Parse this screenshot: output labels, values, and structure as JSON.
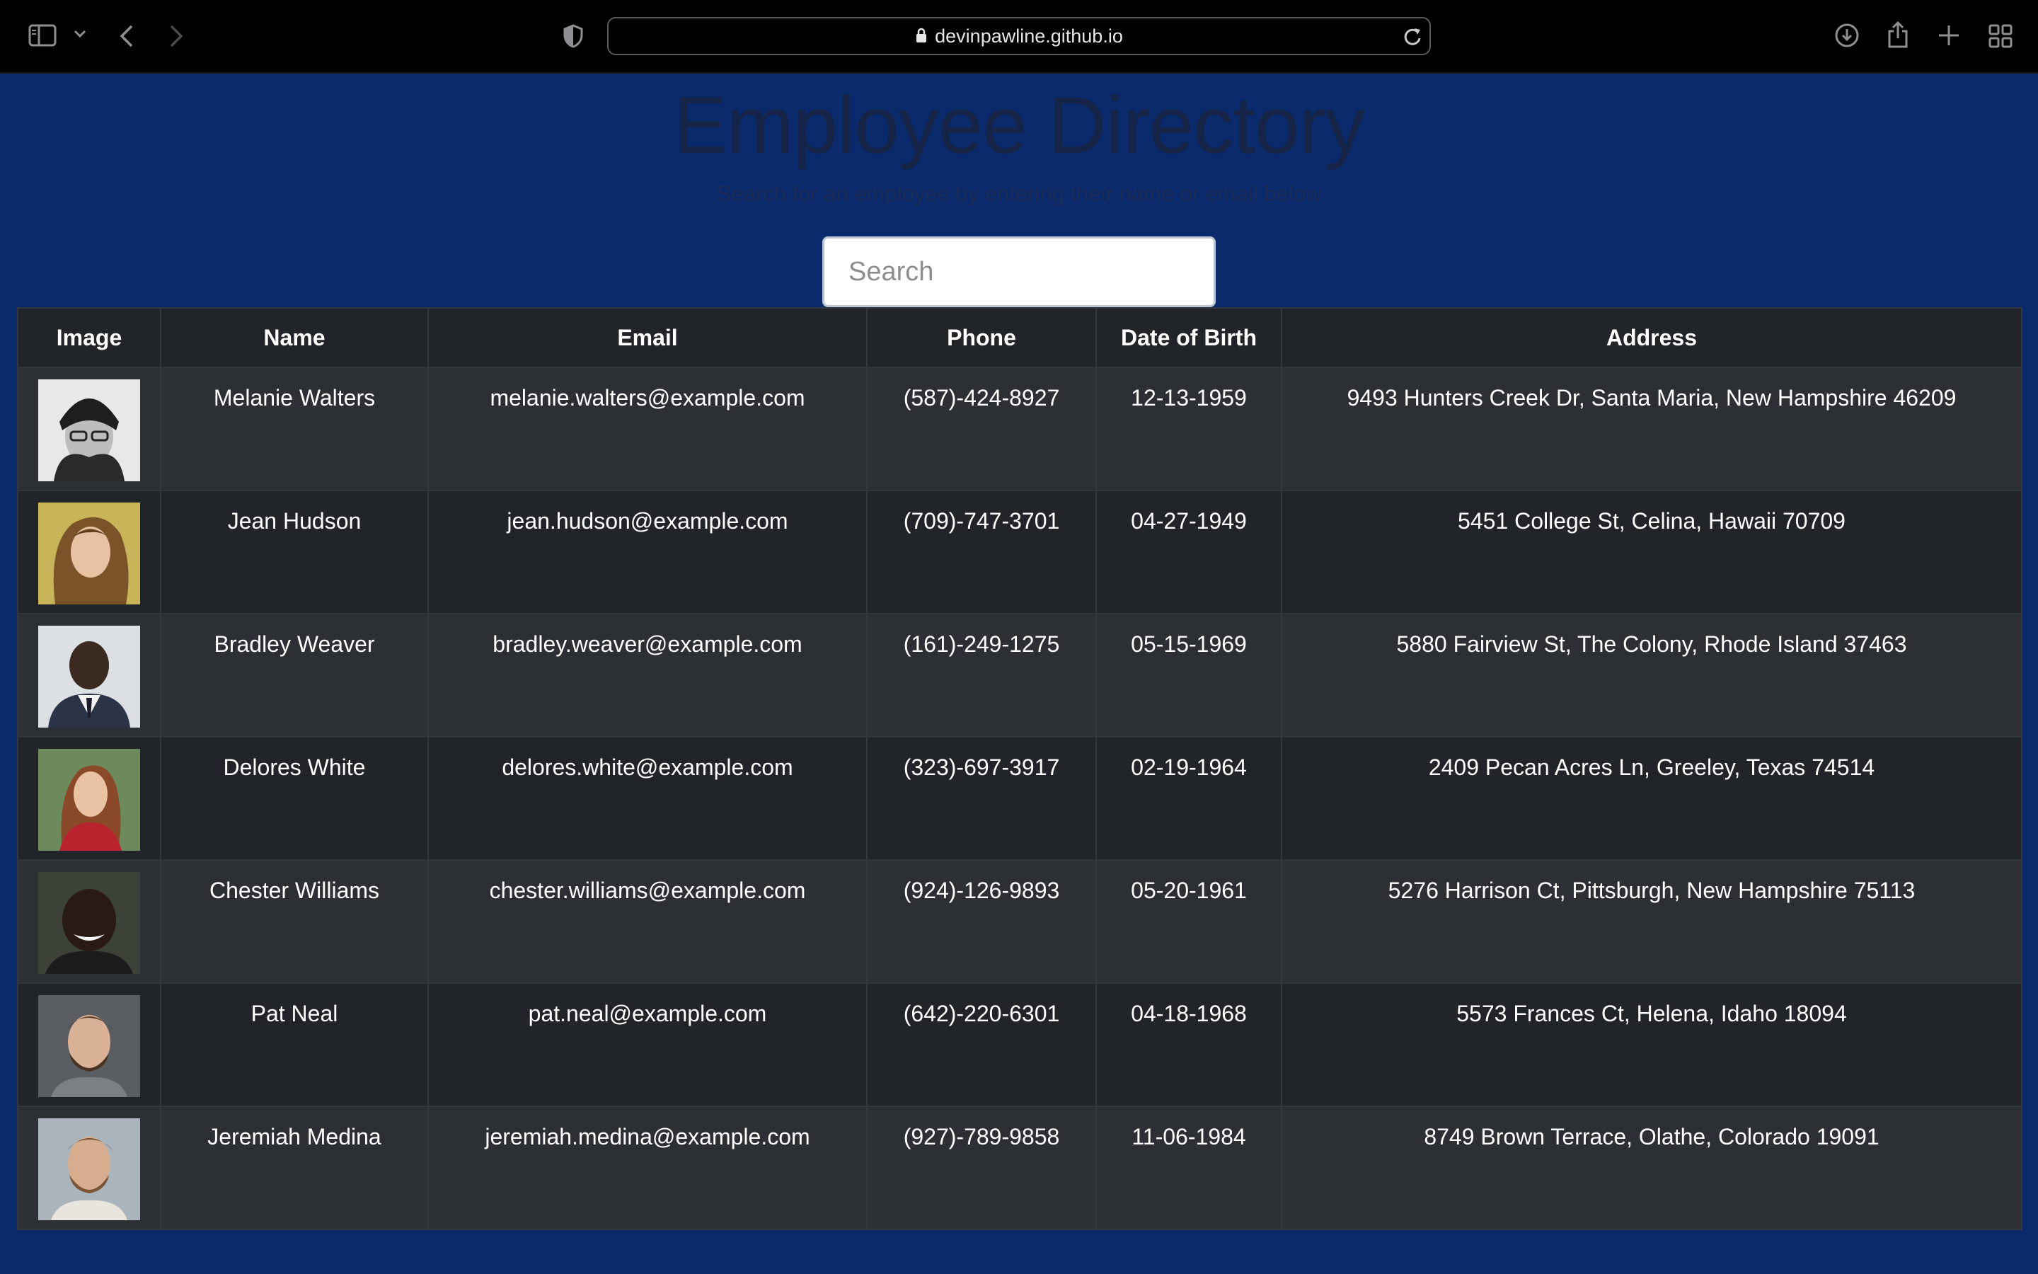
{
  "browser": {
    "url_host": "devinpawline.github.io"
  },
  "header": {
    "title": "Employee Directory",
    "subtitle": "Search for an employee by entering their name or email below"
  },
  "search": {
    "placeholder": "Search",
    "value": ""
  },
  "table": {
    "columns": [
      "Image",
      "Name",
      "Email",
      "Phone",
      "Date of Birth",
      "Address"
    ],
    "rows": [
      {
        "name": "Melanie Walters",
        "email": "melanie.walters@example.com",
        "phone": "(587)-424-8927",
        "dob": "12-13-1959",
        "address": "9493 Hunters Creek Dr, Santa Maria, New Hampshire 46209",
        "photo": "woman-beanie-glasses-bw"
      },
      {
        "name": "Jean Hudson",
        "email": "jean.hudson@example.com",
        "phone": "(709)-747-3701",
        "dob": "04-27-1949",
        "address": "5451 College St, Celina, Hawaii 70709",
        "photo": "woman-long-brown-hair"
      },
      {
        "name": "Bradley Weaver",
        "email": "bradley.weaver@example.com",
        "phone": "(161)-249-1275",
        "dob": "05-15-1969",
        "address": "5880 Fairview St, The Colony, Rhode Island 37463",
        "photo": "man-suit-tie"
      },
      {
        "name": "Delores White",
        "email": "delores.white@example.com",
        "phone": "(323)-697-3917",
        "dob": "02-19-1964",
        "address": "2409 Pecan Acres Ln, Greeley, Texas 74514",
        "photo": "woman-red-top"
      },
      {
        "name": "Chester Williams",
        "email": "chester.williams@example.com",
        "phone": "(924)-126-9893",
        "dob": "05-20-1961",
        "address": "5276 Harrison Ct, Pittsburgh, New Hampshire 75113",
        "photo": "man-smiling"
      },
      {
        "name": "Pat Neal",
        "email": "pat.neal@example.com",
        "phone": "(642)-220-6301",
        "dob": "04-18-1968",
        "address": "5573 Frances Ct, Helena, Idaho 18094",
        "photo": "man-beard"
      },
      {
        "name": "Jeremiah Medina",
        "email": "jeremiah.medina@example.com",
        "phone": "(927)-789-9858",
        "dob": "11-06-1984",
        "address": "8749 Brown Terrace, Olathe, Colorado 19091",
        "photo": "man-beard-outdoor"
      }
    ]
  },
  "colors": {
    "page_background": "#0a2a6b",
    "table_header": "#212529",
    "row_odd": "#2c3034",
    "row_even": "#212529",
    "text": "#ffffff"
  }
}
